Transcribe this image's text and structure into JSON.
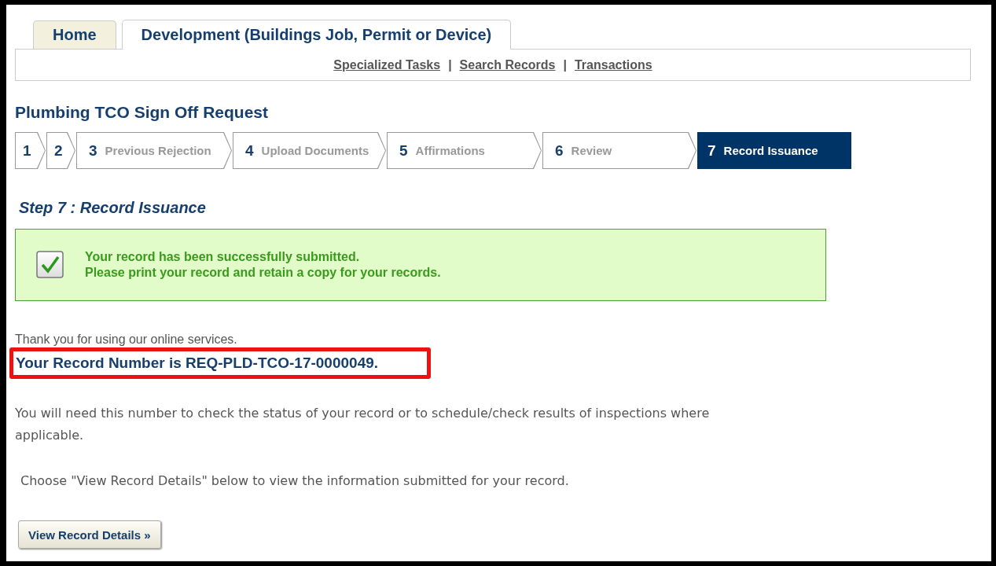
{
  "tabs": [
    {
      "label": "Home",
      "selected": false
    },
    {
      "label": "Development (Buildings Job, Permit or Device)",
      "selected": true
    }
  ],
  "subnav": [
    {
      "label": "Specialized Tasks"
    },
    {
      "separator": "|",
      "label": "Search Records"
    },
    {
      "separator": "|",
      "label": "Transactions"
    }
  ],
  "title": "Plumbing TCO Sign Off Request",
  "steps": [
    {
      "number": "1",
      "selected": false
    },
    {
      "number": "2",
      "selected": false
    },
    {
      "number": "3",
      "label": "Previous Rejection",
      "selected": false
    },
    {
      "number": "4",
      "label": "Upload Documents",
      "selected": false
    },
    {
      "number": "5",
      "label": "Affirmations",
      "selected": false
    },
    {
      "number": "6",
      "label": "Review",
      "selected": false
    },
    {
      "number": "7",
      "label": "Record Issuance",
      "selected": true
    }
  ],
  "step_heading": "Step 7 : Record Issuance",
  "success": {
    "lines": [
      "Your record has been successfully submitted.",
      "Please print your record and retain a copy for your records."
    ]
  },
  "thanks": "Thank you for using our online services.",
  "record_number": "Your Record Number is REQ-PLD-TCO-17-0000049.",
  "paragraphs": [
    "You will need this number to check the status of your record or to schedule/check results of inspections where applicable.",
    "Choose \"View Record Details\" below to view the information submitted for your record."
  ],
  "button": "View Record Details »"
}
